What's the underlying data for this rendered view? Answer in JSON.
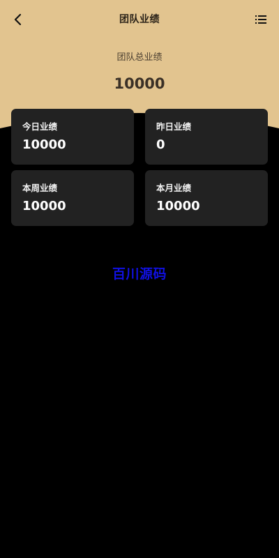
{
  "colors": {
    "hero_background": "#e2c48f",
    "page_background": "#000000",
    "card_background": "#222222",
    "watermark": "#1010e0"
  },
  "header": {
    "title": "团队业绩",
    "back_icon": "chevron-left-icon",
    "menu_icon": "list-menu-icon"
  },
  "summary": {
    "label": "团队总业绩",
    "value": "10000"
  },
  "stats": [
    {
      "label": "今日业绩",
      "value": "10000"
    },
    {
      "label": "昨日业绩",
      "value": "0"
    },
    {
      "label": "本周业绩",
      "value": "10000"
    },
    {
      "label": "本月业绩",
      "value": "10000"
    }
  ],
  "watermark": {
    "text": "百川源码"
  }
}
